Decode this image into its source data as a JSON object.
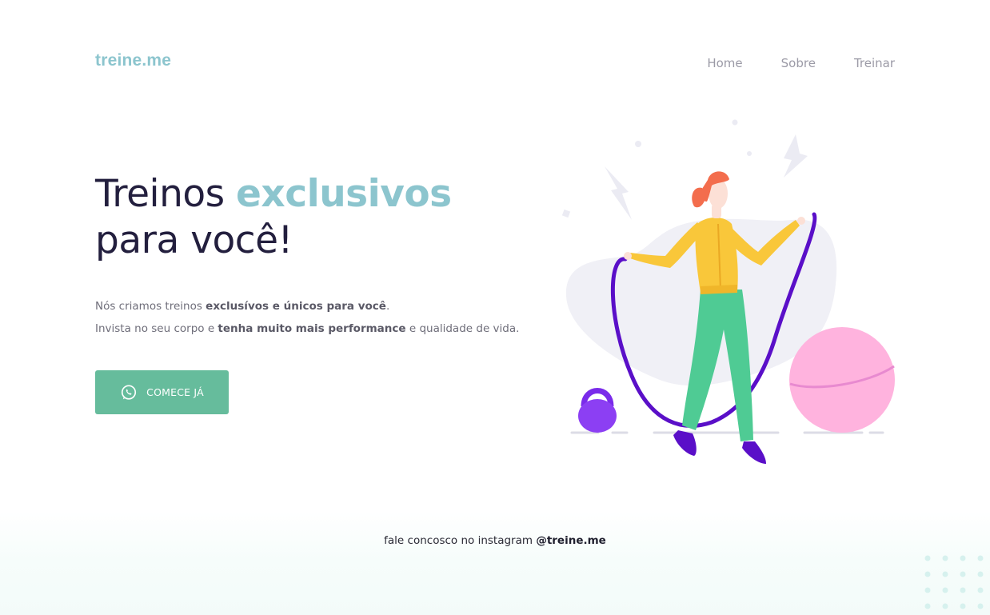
{
  "brand": {
    "logo_text": "treine.me",
    "accent_color": "#8cc5ce",
    "button_color": "#66bc9c",
    "text_dark": "#231f3e"
  },
  "nav": {
    "items": [
      {
        "label": "Home"
      },
      {
        "label": "Sobre"
      },
      {
        "label": "Treinar"
      }
    ]
  },
  "hero": {
    "title_part1": "Treinos ",
    "title_highlight": "exclusivos",
    "title_line2": "para você!",
    "description": {
      "line1_prefix": "Nós criamos treinos ",
      "line1_bold": "exclusívos e únicos para você",
      "line1_suffix": ".",
      "line2_prefix": "Invista no seu corpo e ",
      "line2_bold": "tenha muito mais performance",
      "line2_suffix": " e qualidade de vida."
    },
    "cta": {
      "label": "COMECE JÁ",
      "icon": "whatsapp-icon"
    }
  },
  "illustration": {
    "subject": "woman-jumping-rope",
    "colors": {
      "hair": "#f36d4d",
      "skin": "#fce0d6",
      "hoodie": "#f9c73a",
      "pants": "#4fcb94",
      "rope": "#5a0fc8",
      "shoes": "#5a0fc8",
      "kettlebell": "#8a3df2",
      "ball": "#ffb1de",
      "blob": "#f0f0f5"
    }
  },
  "footer": {
    "text": "fale concosco no instagram ",
    "handle": "@treine.me"
  }
}
